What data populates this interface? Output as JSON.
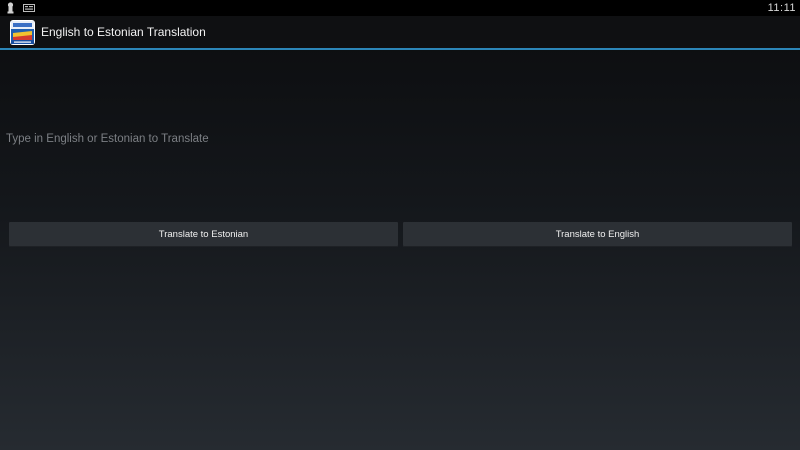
{
  "status_bar": {
    "time": "11:11",
    "icons": [
      "usb-debug-icon",
      "notification-icon"
    ]
  },
  "action_bar": {
    "title": "English to Estonian Translation",
    "icon": "app-flag-icon",
    "accent_color": "#2c86b8"
  },
  "input": {
    "value": "",
    "placeholder": "Type in English or Estonian to Translate"
  },
  "buttons": {
    "to_estonian": "Translate to Estonian",
    "to_english": "Translate to English"
  },
  "colors": {
    "background_top": "#0b0c0e",
    "background_bottom": "#262b31",
    "button": "#2c3035"
  }
}
